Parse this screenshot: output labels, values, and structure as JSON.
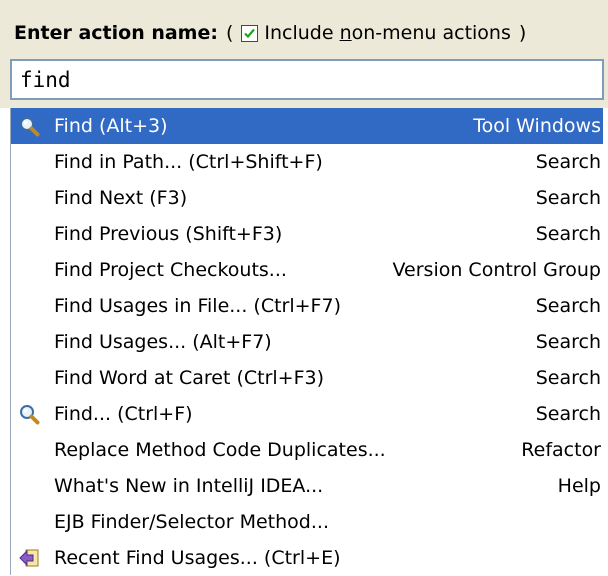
{
  "header": {
    "label": "Enter action name:",
    "paren_open": "(",
    "paren_close": ")",
    "checkbox_checked": true,
    "checkbox_label_pre": "Include ",
    "checkbox_label_mnemonic": "n",
    "checkbox_label_post": "on-menu actions"
  },
  "search": {
    "value": "find"
  },
  "colors": {
    "selection": "#316ac5",
    "header_bg": "#ece9d8"
  },
  "items": [
    {
      "label": "Find (Alt+3)",
      "group": "Tool Windows",
      "icon": "magnifier-icon",
      "selected": true
    },
    {
      "label": "Find in Path... (Ctrl+Shift+F)",
      "group": "Search",
      "icon": "",
      "selected": false
    },
    {
      "label": "Find Next (F3)",
      "group": "Search",
      "icon": "",
      "selected": false
    },
    {
      "label": "Find Previous (Shift+F3)",
      "group": "Search",
      "icon": "",
      "selected": false
    },
    {
      "label": "Find Project Checkouts...",
      "group": "Version Control Group",
      "icon": "",
      "selected": false
    },
    {
      "label": "Find Usages in File... (Ctrl+F7)",
      "group": "Search",
      "icon": "",
      "selected": false
    },
    {
      "label": "Find Usages... (Alt+F7)",
      "group": "Search",
      "icon": "",
      "selected": false
    },
    {
      "label": "Find Word at Caret (Ctrl+F3)",
      "group": "Search",
      "icon": "",
      "selected": false
    },
    {
      "label": "Find... (Ctrl+F)",
      "group": "Search",
      "icon": "magnifier-icon",
      "selected": false
    },
    {
      "label": "Replace Method Code Duplicates...",
      "group": "Refactor",
      "icon": "",
      "selected": false
    },
    {
      "label": "What's New in IntelliJ IDEA...",
      "group": "Help",
      "icon": "",
      "selected": false
    },
    {
      "label": "EJB Finder/Selector Method...",
      "group": "",
      "icon": "",
      "selected": false
    },
    {
      "label": "Recent Find Usages... (Ctrl+E)",
      "group": "",
      "icon": "recent-arrow-icon",
      "selected": false
    }
  ]
}
